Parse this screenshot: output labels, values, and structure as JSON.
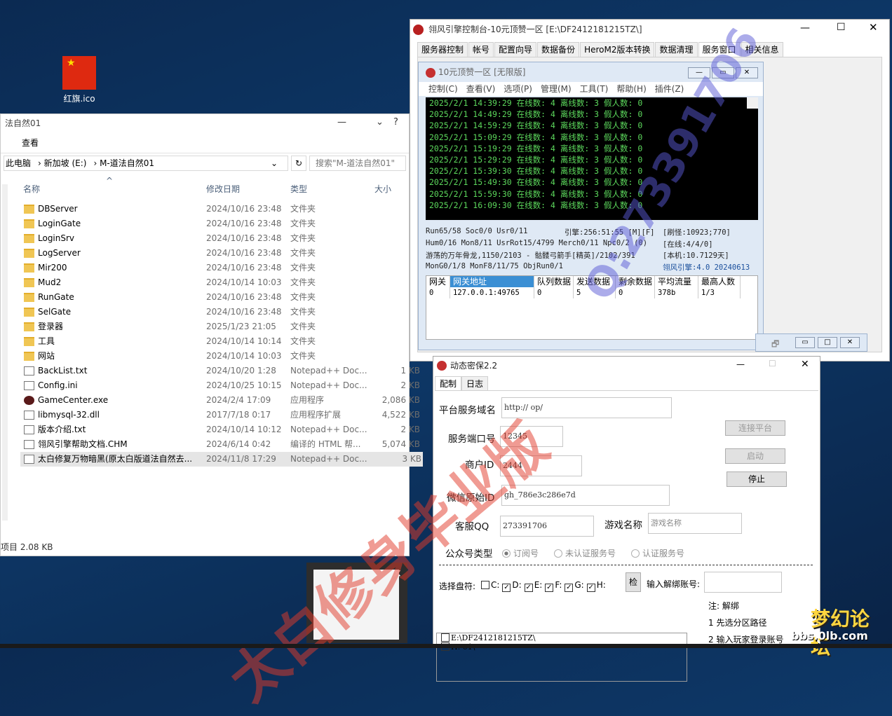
{
  "desktop": {
    "icon_label": "红旗.ico"
  },
  "explorer": {
    "title": "法自然01",
    "menu_view": "查看",
    "breadcrumb": [
      "此电脑",
      "新加坡 (E:)",
      "M-道法自然01"
    ],
    "search_placeholder": "搜索\"M-道法自然01\"",
    "columns": {
      "name": "名称",
      "date": "修改日期",
      "type": "类型",
      "size": "大小"
    },
    "files": [
      {
        "name": "DBServer",
        "date": "2024/10/16 23:48",
        "type": "文件夹",
        "size": "",
        "kind": "folder"
      },
      {
        "name": "LoginGate",
        "date": "2024/10/16 23:48",
        "type": "文件夹",
        "size": "",
        "kind": "folder"
      },
      {
        "name": "LoginSrv",
        "date": "2024/10/16 23:48",
        "type": "文件夹",
        "size": "",
        "kind": "folder"
      },
      {
        "name": "LogServer",
        "date": "2024/10/16 23:48",
        "type": "文件夹",
        "size": "",
        "kind": "folder"
      },
      {
        "name": "Mir200",
        "date": "2024/10/16 23:48",
        "type": "文件夹",
        "size": "",
        "kind": "folder"
      },
      {
        "name": "Mud2",
        "date": "2024/10/14 10:03",
        "type": "文件夹",
        "size": "",
        "kind": "folder"
      },
      {
        "name": "RunGate",
        "date": "2024/10/16 23:48",
        "type": "文件夹",
        "size": "",
        "kind": "folder"
      },
      {
        "name": "SelGate",
        "date": "2024/10/16 23:48",
        "type": "文件夹",
        "size": "",
        "kind": "folder"
      },
      {
        "name": "登录器",
        "date": "2025/1/23 21:05",
        "type": "文件夹",
        "size": "",
        "kind": "folder"
      },
      {
        "name": "工具",
        "date": "2024/10/14 10:14",
        "type": "文件夹",
        "size": "",
        "kind": "folder"
      },
      {
        "name": "网站",
        "date": "2024/10/14 10:03",
        "type": "文件夹",
        "size": "",
        "kind": "folder"
      },
      {
        "name": "BackList.txt",
        "date": "2024/10/20 1:28",
        "type": "Notepad++ Doc...",
        "size": "1 KB",
        "kind": "file"
      },
      {
        "name": "Config.ini",
        "date": "2024/10/25 10:15",
        "type": "Notepad++ Doc...",
        "size": "2 KB",
        "kind": "file"
      },
      {
        "name": "GameCenter.exe",
        "date": "2024/2/4 17:09",
        "type": "应用程序",
        "size": "2,086 KB",
        "kind": "exe"
      },
      {
        "name": "libmysql-32.dll",
        "date": "2017/7/18 0:17",
        "type": "应用程序扩展",
        "size": "4,522 KB",
        "kind": "file"
      },
      {
        "name": "版本介绍.txt",
        "date": "2024/10/14 10:12",
        "type": "Notepad++ Doc...",
        "size": "2 KB",
        "kind": "file"
      },
      {
        "name": "翎风引擎帮助文档.CHM",
        "date": "2024/6/14 0:42",
        "type": "编译的 HTML 帮...",
        "size": "5,074 KB",
        "kind": "file"
      },
      {
        "name": "太白修复万物暗黑(原太白版道法自然去...",
        "date": "2024/11/8 17:29",
        "type": "Notepad++ Doc...",
        "size": "3 KB",
        "kind": "file"
      }
    ],
    "status": "项目  2.08 KB"
  },
  "engine": {
    "title": "翎风引擎控制台-10元顶赞一区 [E:\\DF2412181215TZ\\]",
    "tabs": [
      "服务器控制",
      "帐号",
      "配置向导",
      "数据备份",
      "HeroM2版本转换",
      "数据清理",
      "服务窗口",
      "相关信息"
    ],
    "active_tab": "服务窗口"
  },
  "server": {
    "title": "10元顶赞一区 [无限版]",
    "menu": [
      "控制(C)",
      "查看(V)",
      "选项(P)",
      "管理(M)",
      "工具(T)",
      "帮助(H)",
      "插件(Z)"
    ],
    "log": [
      "2025/2/1 14:39:29 在线数: 4 离线数: 3 假人数: 0",
      "2025/2/1 14:49:29 在线数: 4 离线数: 3 假人数: 0",
      "2025/2/1 14:59:29 在线数: 4 离线数: 3 假人数: 0",
      "2025/2/1 15:09:29 在线数: 4 离线数: 3 假人数: 0",
      "2025/2/1 15:19:29 在线数: 4 离线数: 3 假人数: 0",
      "2025/2/1 15:29:29 在线数: 4 离线数: 3 假人数: 0",
      "2025/2/1 15:39:30 在线数: 4 离线数: 3 假人数: 0",
      "2025/2/1 15:49:30 在线数: 4 离线数: 3 假人数: 0",
      "2025/2/1 15:59:30 在线数: 4 离线数: 3 假人数: 0",
      "2025/2/1 16:09:30 在线数: 4 离线数: 3 假人数: 0"
    ],
    "stats": [
      {
        "left": "Run65/58 Soc0/0 Usr0/11",
        "mid": "引擎:256:51:55 [M][F]",
        "right": "[刷怪:10923;770]"
      },
      {
        "left": "Hum0/16 Mon8/11 UsrRot15/4799 Merch0/11 Npc0/2 (0)",
        "mid": "",
        "right": "[在线:4/4/0]"
      },
      {
        "left": "游荡的万年骨龙,1150/2103 - 骷髅弓箭手[精英]/2102/391",
        "mid": "",
        "right": "[本机:10.7129天]"
      },
      {
        "left": "MonG0/1/8 MonF8/11/75 ObjRun0/1",
        "mid": "",
        "right": "翎风引擎:4.0 20240613"
      }
    ],
    "gateway_headers": [
      "网关",
      "网关地址",
      "队列数据",
      "发送数据",
      "剩余数据",
      "平均流量",
      "最高人数"
    ],
    "gateway_rows": [
      [
        "0",
        "127.0.0.1:49765",
        "0",
        "5",
        "0",
        "378b",
        "1/3"
      ]
    ]
  },
  "dynamic": {
    "title": "动态密保2.2",
    "tabs": [
      "配制",
      "日志"
    ],
    "platform_label": "平台服务域名",
    "platform_value": "http://            op/",
    "port_label": "服务端口号",
    "port_value": "12345",
    "merchant_label": "商户ID",
    "merchant_value": "2444",
    "wechat_label": "微信原始ID",
    "wechat_value": "gh_786e3c286e7d",
    "qq_label": "客服QQ",
    "qq_value": "273391706",
    "game_label": "游戏名称",
    "game_placeholder": "游戏名称",
    "btn_connect": "连接平台",
    "btn_start": "启动",
    "btn_stop": "停止",
    "account_type_label": "公众号类型",
    "account_types": [
      "订阅号",
      "未认证服务号",
      "认证服务号"
    ],
    "drive_label": "选择盘符:",
    "drives": [
      {
        "letter": "C:",
        "checked": false
      },
      {
        "letter": "D:",
        "checked": true
      },
      {
        "letter": "E:",
        "checked": true
      },
      {
        "letter": "F:",
        "checked": true
      },
      {
        "letter": "G:",
        "checked": true
      },
      {
        "letter": "H:",
        "checked": true
      }
    ],
    "check_btn": "检",
    "unbind_label": "输入解绑账号:",
    "paths": [
      "E:\\DF2412181215TZ\\",
      "H:            01\\"
    ],
    "notes": [
      "注: 解绑",
      "1 先选分区路径",
      "2 输入玩家登录账号"
    ]
  },
  "watermark": {
    "text": "太白修身毕业版",
    "qq": "Q:273391706"
  },
  "corner_logo": {
    "title": "梦幻论坛",
    "site": "bbs.0lb.com"
  }
}
